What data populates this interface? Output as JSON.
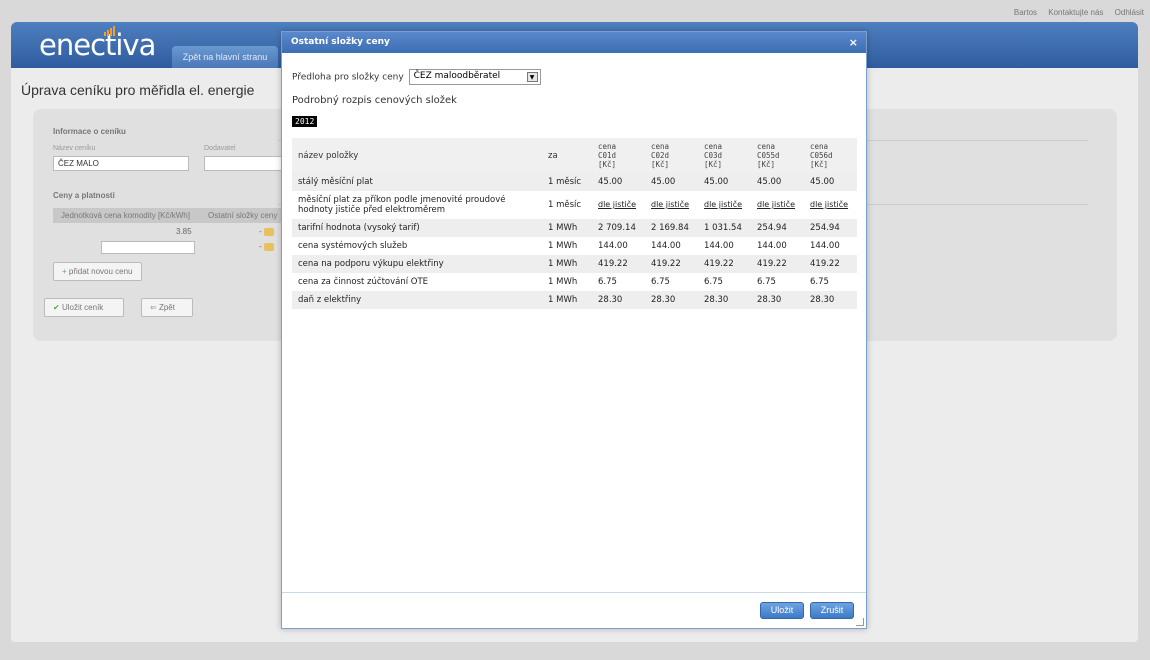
{
  "top_links": [
    "Bartos",
    "Kontaktujte nás",
    "Odhlásit"
  ],
  "logo": "enectiva",
  "nav_tab": "Zpět na hlavní stranu",
  "page_title": "Úprava ceníku pro měřidla el. energie",
  "form": {
    "section1_title": "Informace o ceníku",
    "name_label": "Název ceníku",
    "name_value": "ČEZ MALO",
    "supplier_label": "Dodavatel",
    "section2_title": "Ceny a platnosti",
    "grid_col1": "Jednotková cena komodity [Kč/kWh]",
    "grid_col2": "Ostatní složky ceny",
    "grid_value": "3.85",
    "dash1": "-",
    "dash2": "-",
    "add_price_button": "přidat novou cenu",
    "save_button": "Uložit ceník",
    "back_button": "Zpět"
  },
  "dialog": {
    "title": "Ostatní složky ceny",
    "close": "×",
    "template_label": "Předloha pro složky ceny",
    "template_value": "ČEZ maloodběratel",
    "subtitle": "Podrobný rozpis cenových složek",
    "year": "2012",
    "table": {
      "headers": {
        "name": "název položky",
        "unit": "za",
        "c1": [
          "cena",
          "C01d",
          "[Kč]"
        ],
        "c2": [
          "cena",
          "C02d",
          "[Kč]"
        ],
        "c3": [
          "cena",
          "C03d",
          "[Kč]"
        ],
        "c4": [
          "cena",
          "C055d",
          "[Kč]"
        ],
        "c5": [
          "cena",
          "C056d",
          "[Kč]"
        ]
      },
      "rows": [
        {
          "name": "stálý měsíční plat",
          "unit": "1 měsíc",
          "v": [
            "45.00",
            "45.00",
            "45.00",
            "45.00",
            "45.00"
          ]
        },
        {
          "name": "měsíční plat za příkon podle jmenovité proudové hodnoty jističe před elektroměrem",
          "unit": "1 měsíc",
          "v": [
            "dle jističe",
            "dle jističe",
            "dle jističe",
            "dle jističe",
            "dle jističe"
          ]
        },
        {
          "name": "tarifní hodnota (vysoký tarif)",
          "unit": "1 MWh",
          "v": [
            "2 709.14",
            "2 169.84",
            "1 031.54",
            "254.94",
            "254.94"
          ]
        },
        {
          "name": "cena systémových služeb",
          "unit": "1 MWh",
          "v": [
            "144.00",
            "144.00",
            "144.00",
            "144.00",
            "144.00"
          ]
        },
        {
          "name": "cena na podporu výkupu elektřiny",
          "unit": "1 MWh",
          "v": [
            "419.22",
            "419.22",
            "419.22",
            "419.22",
            "419.22"
          ]
        },
        {
          "name": "cena za činnost zúčtování OTE",
          "unit": "1 MWh",
          "v": [
            "6.75",
            "6.75",
            "6.75",
            "6.75",
            "6.75"
          ]
        },
        {
          "name": "daň z elektřiny",
          "unit": "1 MWh",
          "v": [
            "28.30",
            "28.30",
            "28.30",
            "28.30",
            "28.30"
          ]
        }
      ]
    },
    "ok_button": "Uložit",
    "cancel_button": "Zrušit"
  }
}
